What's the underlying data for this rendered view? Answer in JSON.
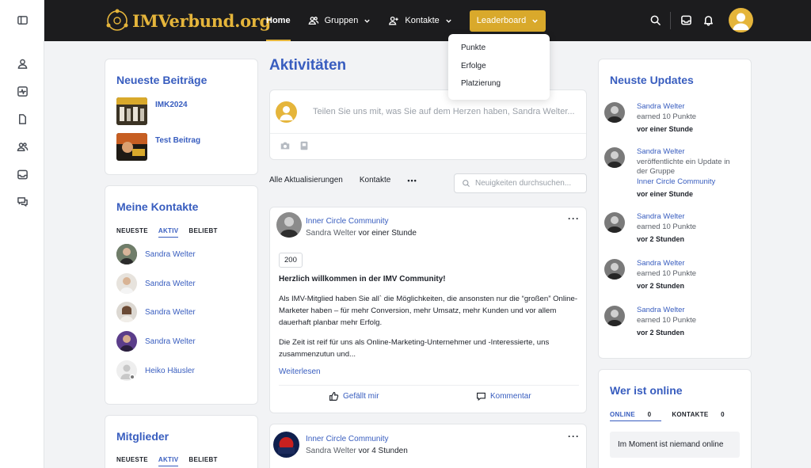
{
  "brand": {
    "name": "IMVerbund.org",
    "accent": "#e5b53b",
    "link_color": "#385dbf"
  },
  "rail": [
    "sidebar-toggle-icon",
    "profile-icon",
    "activity-icon",
    "document-icon",
    "groups-icon",
    "inbox-icon",
    "chat-icon"
  ],
  "nav": {
    "home": "Home",
    "groups": "Gruppen",
    "contacts": "Kontakte",
    "leaderboard": "Leaderboard"
  },
  "leaderboard_menu": [
    "Punkte",
    "Erfolge",
    "Platzierung"
  ],
  "recent_posts": {
    "title": "Neueste Beiträge",
    "items": [
      {
        "title": "IMK2024"
      },
      {
        "title": "Test Beitrag"
      }
    ]
  },
  "my_contacts": {
    "title": "Meine Kontakte",
    "tabs": [
      "NEUESTE",
      "AKTIV",
      "BELIEBT"
    ],
    "active_tab": "AKTIV",
    "items": [
      {
        "name": "Sandra Welter"
      },
      {
        "name": "Sandra Welter"
      },
      {
        "name": "Sandra Welter"
      },
      {
        "name": "Sandra Welter"
      },
      {
        "name": "Heiko Häusler"
      }
    ]
  },
  "members": {
    "title": "Mitglieder",
    "tabs": [
      "NEUESTE",
      "AKTIV",
      "BELIEBT"
    ],
    "active_tab": "AKTIV"
  },
  "activity": {
    "title": "Aktivitäten",
    "composer_placeholder": "Teilen Sie uns mit, was Sie auf dem Herzen haben, Sandra Welter...",
    "filters": {
      "all": "Alle Aktualisierungen",
      "contacts": "Kontakte",
      "more": "•••"
    },
    "search_placeholder": "Neuigkeiten durchsuchen...",
    "posts": [
      {
        "group": "Inner Circle Community",
        "author": "Sandra Welter",
        "time": "vor einer Stunde",
        "badge": "200",
        "headline": "Herzlich willkommen in der IMV Community!",
        "para1": "Als IMV-Mitglied haben Sie all` die Möglichkeiten, die ansonsten nur die “großen” Online-Marketer haben – für mehr Conversion, mehr Umsatz, mehr Kunden und vor allem dauerhaft planbar mehr Erfolg.",
        "para2": "Die Zeit ist reif für uns als Online-Marketing-Unternehmer und -Interessierte, uns zusammenzutun und...",
        "read_more": "Weiterlesen",
        "like": "Gefällt mir",
        "comment": "Kommentar"
      },
      {
        "group": "Inner Circle Community",
        "author": "Sandra Welter",
        "time": "vor 4 Stunden"
      }
    ]
  },
  "updates": {
    "title": "Neuste Updates",
    "items": [
      {
        "name": "Sandra Welter",
        "text": "earned 10 Punkte",
        "group": "",
        "time": "vor einer Stunde"
      },
      {
        "name": "Sandra Welter",
        "text": "veröffentlichte ein Update in der Gruppe",
        "group": "Inner Circle Community",
        "time": "vor einer Stunde"
      },
      {
        "name": "Sandra Welter",
        "text": "earned 10 Punkte",
        "group": "",
        "time": "vor 2 Stunden"
      },
      {
        "name": "Sandra Welter",
        "text": "earned 10 Punkte",
        "group": "",
        "time": "vor 2 Stunden"
      },
      {
        "name": "Sandra Welter",
        "text": "earned 10 Punkte",
        "group": "",
        "time": "vor 2 Stunden"
      }
    ]
  },
  "online": {
    "title": "Wer ist online",
    "tab_online": "ONLINE",
    "tab_online_count": "0",
    "tab_contacts": "KONTAKTE",
    "tab_contacts_count": "0",
    "empty": "Im Moment ist niemand online"
  }
}
